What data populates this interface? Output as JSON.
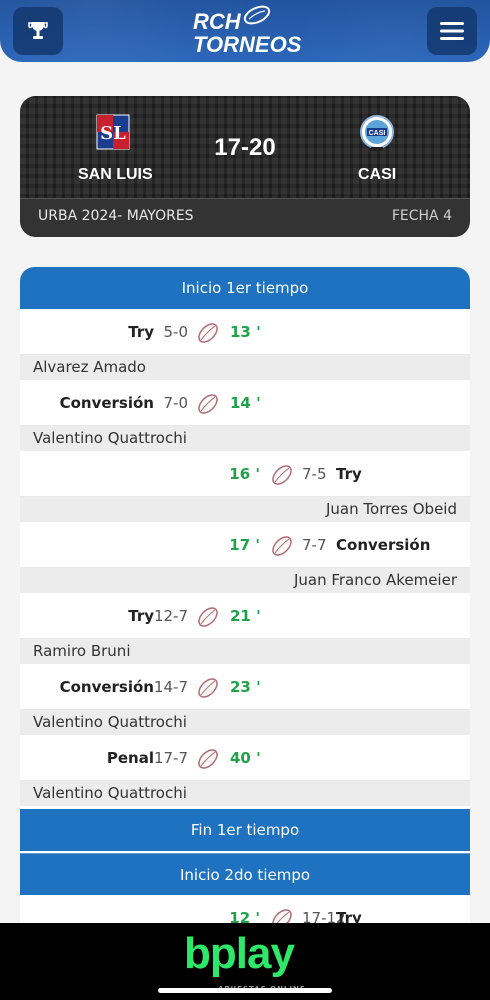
{
  "header": {
    "logo_line1": "RCH",
    "logo_line2": "TORNEOS",
    "left_icon": "trophy-icon",
    "right_icon": "menu-icon"
  },
  "match": {
    "home_team": "SAN LUIS",
    "away_team": "CASI",
    "score": "17-20",
    "tournament": "URBA 2024- MAYORES",
    "round": "FECHA 4"
  },
  "timeline": {
    "first_half_start": "Inicio 1er tiempo",
    "first_half_end": "Fin 1er tiempo",
    "second_half_start": "Inicio 2do tiempo",
    "events": [
      {
        "side": "home",
        "type": "Try",
        "score": "5-0",
        "minute": "13 '",
        "player": "Alvarez Amado"
      },
      {
        "side": "home",
        "type": "Conversión",
        "score": "7-0",
        "minute": "14 '",
        "player": "Valentino Quattrochi"
      },
      {
        "side": "away",
        "type": "Try",
        "score": "7-5",
        "minute": "16 '",
        "player": "Juan Torres Obeid"
      },
      {
        "side": "away",
        "type": "Conversión",
        "score": "7-7",
        "minute": "17 '",
        "player": "Juan Franco Akemeier"
      },
      {
        "side": "home",
        "type": "Try",
        "score": "12-7",
        "minute": "21 '",
        "player": "Ramiro Bruni"
      },
      {
        "side": "home",
        "type": "Conversión",
        "score": "14-7",
        "minute": "23 '",
        "player": "Valentino Quattrochi"
      },
      {
        "side": "home",
        "type": "Penal",
        "score": "17-7",
        "minute": "40 '",
        "player": "Valentino Quattrochi"
      }
    ],
    "partial_event": {
      "side": "away",
      "type": "Try",
      "score": "17-12",
      "minute": "12 '"
    }
  },
  "banner": {
    "brand": "bplay",
    "tagline": "APUESTAS ONLINE"
  },
  "colors": {
    "accent_blue": "#1e72c0",
    "minute_green": "#1fa34a",
    "brand_green": "#2ee86a"
  }
}
